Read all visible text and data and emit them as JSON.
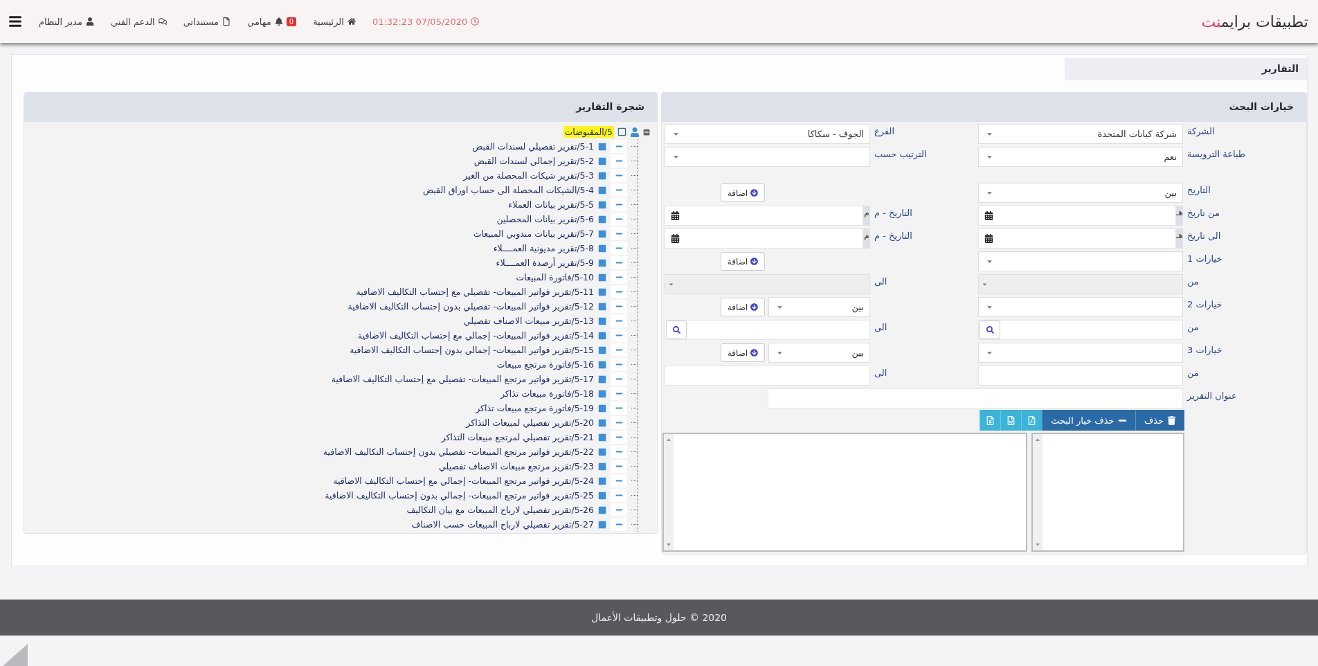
{
  "header": {
    "brand": "تطبيقات برايم",
    "brand_accent": "نت",
    "nav": [
      {
        "kind": "clock",
        "label": "01:32:23 07/05/2020"
      },
      {
        "kind": "home",
        "label": "الرئيسية"
      },
      {
        "kind": "tasks",
        "label": "مهامي",
        "badge": "0"
      },
      {
        "kind": "docs",
        "label": "مستنداتي"
      },
      {
        "kind": "support",
        "label": "الدعم الفني"
      },
      {
        "kind": "user",
        "label": "مدير النظام"
      }
    ]
  },
  "tabs": [
    {
      "label": "التقارير",
      "selected": true
    }
  ],
  "search_options": {
    "title": "خيارات البحث",
    "groups": [
      [
        {
          "cells": [
            {
              "kind": "select",
              "label": "الشركة",
              "value": "شركة كيانات المتحدة"
            },
            {
              "kind": "select",
              "label": "الفرع",
              "value": "الجوف - سكاكا"
            }
          ]
        },
        {
          "cells": [
            {
              "kind": "select",
              "label": "طباعة الترويسة",
              "value": "نعم"
            },
            {
              "kind": "select",
              "label": "الترتيب حسب"
            }
          ]
        }
      ],
      [
        {
          "cells": [
            {
              "kind": "select",
              "label": "التاريخ",
              "value": "بين"
            },
            {
              "kind": "add",
              "button": "اضافة"
            }
          ]
        },
        {
          "cells": [
            {
              "kind": "date",
              "label": "من تاريخ",
              "addon": "هـ"
            },
            {
              "kind": "date",
              "label": "التاريخ - م",
              "addon": "م"
            }
          ]
        },
        {
          "cells": [
            {
              "kind": "date",
              "label": "الى تاريخ",
              "addon": "هـ"
            },
            {
              "kind": "date",
              "label": "التاريخ - م",
              "addon": "م"
            }
          ]
        },
        {
          "cells": [
            {
              "kind": "select",
              "label": "خيارات 1"
            },
            {
              "kind": "add",
              "button": "اضافة"
            }
          ]
        },
        {
          "cells": [
            {
              "kind": "select",
              "label": "من",
              "disabled": true
            },
            {
              "kind": "select",
              "label": "الى",
              "disabled": true
            }
          ]
        },
        {
          "cells": [
            {
              "kind": "select",
              "label": "خيارات 2"
            },
            {
              "kind": "add",
              "button": "اضافة",
              "select": "بين"
            }
          ]
        },
        {
          "cells": [
            {
              "kind": "search",
              "label": "من"
            },
            {
              "kind": "search",
              "label": "الى"
            }
          ]
        },
        {
          "cells": [
            {
              "kind": "select",
              "label": "خيارات 3"
            },
            {
              "kind": "add",
              "button": "اضافة",
              "select": "بين"
            }
          ]
        },
        {
          "cells": [
            {
              "kind": "text",
              "label": "من"
            },
            {
              "kind": "text",
              "label": "الى"
            }
          ]
        }
      ]
    ],
    "report_title_label": "عنوان التقرير",
    "toolbar": [
      {
        "kind": "delete",
        "label": "حذف"
      },
      {
        "kind": "remove",
        "label": "حذف خيار البحث"
      },
      {
        "kind": "pdf"
      },
      {
        "kind": "word"
      },
      {
        "kind": "excel"
      }
    ]
  },
  "tree": {
    "title": "شجرة التقارير",
    "root": {
      "label": "5/المقبوضات",
      "selected": true,
      "expanded": true,
      "checked": false,
      "children": [
        {
          "label": "5-1/تقرير تفصيلي لسندات القبض",
          "selected": false
        },
        {
          "label": "5-2/تقرير إجمالي لسندات القبض",
          "selected": false
        },
        {
          "label": "5-3/تقرير شيكات المحصلة من الغير",
          "selected": false
        },
        {
          "label": "5-4/الشيكات المحصلة الى حساب اوراق القبض",
          "selected": false
        },
        {
          "label": "5-5/تقرير بيانات العملاء",
          "selected": false
        },
        {
          "label": "5-6/تقرير بيانات المحصلين",
          "selected": false
        },
        {
          "label": "5-7/تقرير بيانات مندوبي المبيعات",
          "selected": false
        },
        {
          "label": "5-8/تقرير مديونية العمــــلاء",
          "selected": false
        },
        {
          "label": "5-9/تقرير أرصدة العمــــلاء",
          "selected": false
        },
        {
          "label": "5-10/فاتورة المبيعات",
          "selected": false
        },
        {
          "label": "5-11/تقرير فواتير المبيعات- تفصيلي مع إحتساب التكاليف الاضافية",
          "selected": false
        },
        {
          "label": "5-12/تقرير فواتير المبيعات- تفصيلي بدون إحتساب التكاليف الاضافية",
          "selected": false
        },
        {
          "label": "5-13/تقرير مبيعات الاصناف تفصيلي",
          "selected": false
        },
        {
          "label": "5-14/تقرير فواتير المبيعات- إجمالي مع إحتساب التكاليف الاضافية",
          "selected": false
        },
        {
          "label": "5-15/تقرير فواتير المبيعات- إجمالي بدون إحتساب التكاليف الاضافية",
          "selected": false
        },
        {
          "label": "5-16/فاتورة مرتجع مبيعات",
          "selected": false
        },
        {
          "label": "5-17/تقرير فواتير مرتجع المبيعات- تفصيلي مع إحتساب التكاليف الاضافية",
          "selected": false
        },
        {
          "label": "5-18/فاتورة مبيعات تذاكر",
          "selected": false
        },
        {
          "label": "5-19/فاتورة مرتجع مبيعات تذاكر",
          "selected": false
        },
        {
          "label": "5-20/تقرير تفصيلي لمبيعات التذاكر",
          "selected": false
        },
        {
          "label": "5-21/تقرير تفصيلي لمرتجع مبيعات التذاكر",
          "selected": false
        },
        {
          "label": "5-22/تقرير فواتير مرتجع المبيعات- تفصيلي بدون إحتساب التكاليف الاضافية",
          "selected": false
        },
        {
          "label": "5-23/تقرير مرتجع مبيعات الاصناف تفصيلي",
          "selected": false
        },
        {
          "label": "5-24/تقرير فواتير مرتجع المبيعات- إجمالي مع إحتساب التكاليف الاضافية",
          "selected": false
        },
        {
          "label": "5-25/تقرير فواتير مرتجع المبيعات- إجمالي بدون إحتساب التكاليف الاضافية",
          "selected": false
        },
        {
          "label": "5-26/تقرير تفصيلي لارباح المبيعات مع بيان التكاليف",
          "selected": false
        },
        {
          "label": "5-27/تقرير تفصيلي لارباح المبيعات حسب الاصناف",
          "selected": false
        }
      ]
    }
  },
  "footer": "2020 © حلول وتطبيقات الأعمال"
}
